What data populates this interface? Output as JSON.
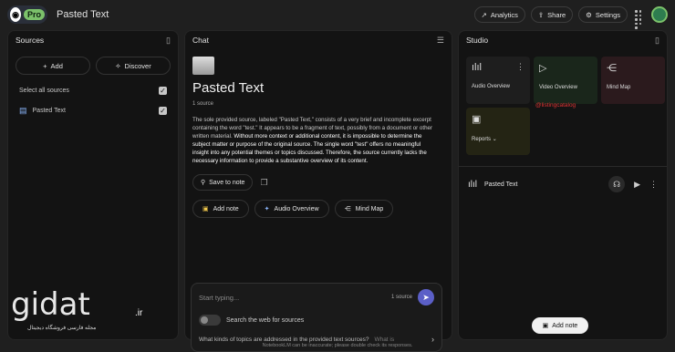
{
  "header": {
    "pro_badge": "Pro",
    "title": "Pasted Text",
    "analytics_label": "Analytics",
    "share_label": "Share",
    "settings_label": "Settings"
  },
  "sources_panel": {
    "title": "Sources",
    "add_label": "Add",
    "discover_label": "Discover",
    "select_all_label": "Select all sources",
    "items": [
      {
        "label": "Pasted Text"
      }
    ]
  },
  "chat_panel": {
    "title": "Chat",
    "notebook_title": "Pasted Text",
    "source_count": "1 source",
    "summary_a": "The sole provided source, labeled \"Pasted Text,\" consists of a very brief and incomplete excerpt containing the word \"test.\" It appears to be a fragment of text, possibly from a document or other written material.",
    "summary_b": " Without more context or additional content, it is impossible to determine the subject matter or purpose of the original source. The single word \"test\" offers no meaningful insight into any potential themes or topics discussed. Therefore, the source currently lacks the necessary information to provide a substantive overview of its content.",
    "save_to_note": "Save to note",
    "actions": [
      "Add note",
      "Audio Overview",
      "Mind Map"
    ],
    "composer_placeholder": "Start typing...",
    "composer_source_count": "1 source",
    "web_search_label": "Search the web for sources",
    "suggestion_1": "What kinds of topics are addressed in the provided text sources?",
    "suggestion_2": "What is"
  },
  "studio_panel": {
    "title": "Studio",
    "tiles": [
      {
        "label": "Audio Overview",
        "icon": "waveform-icon"
      },
      {
        "label": "Video Overview",
        "icon": "play-sparkle-icon"
      },
      {
        "label": "Mind Map",
        "icon": "mind-map-icon"
      },
      {
        "label": "Reports",
        "icon": "report-icon"
      }
    ],
    "audio_item_title": "Pasted Text",
    "add_note_label": "Add note"
  },
  "footer": "NotebookLM can be inaccurate; please double check its responses.",
  "watermark": {
    "text": "gidat",
    "suffix": ".ir",
    "subtitle": "مجله فارسی فروشگاه دیجیتال",
    "tile_overlay": "@listingcatalog"
  }
}
